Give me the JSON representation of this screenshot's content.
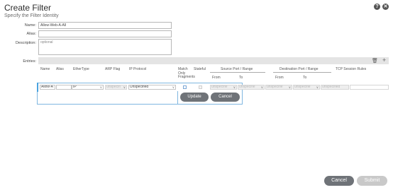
{
  "header": {
    "title": "Create Filter",
    "subtitle": "Specify the Filter Identity",
    "help_icon": "question-icon",
    "close_icon": "close-icon"
  },
  "form": {
    "name_label": "Name:",
    "name_value": "Allow-Web-A-All",
    "alias_label": "Alias:",
    "alias_value": "",
    "description_label": "Description:",
    "description_placeholder": "optional",
    "entries_label": "Entries:"
  },
  "entries": {
    "toolbar_icons": [
      "trash-icon",
      "plus-icon"
    ],
    "columns": {
      "name": "Name",
      "alias": "Alias",
      "ethertype": "EtherType",
      "arp_flag": "ARP Flag",
      "ip_protocol": "IP Protocol",
      "match_only_fragments": [
        "Match",
        "Only",
        "Fragments"
      ],
      "stateful": "Stateful",
      "source_port_range": "Source Port / Range",
      "destination_port_range": "Destination Port / Range",
      "tcp_session_rules": "TCP Session Rules",
      "from": "From",
      "to": "To"
    },
    "row": {
      "name": "Allow-A",
      "alias": "",
      "ethertype": "IP",
      "arp_flag": "unspecifi",
      "ip_protocol": "Unspecified",
      "source_from": "unspecifie",
      "source_to": "unspecifie",
      "dest_from": "unspecifie",
      "dest_to": "unspecifie",
      "tcp_session_rules": "unspecified"
    },
    "update_label": "Update",
    "cancel_label": "Cancel"
  },
  "footer": {
    "cancel_label": "Cancel",
    "submit_label": "Submit"
  },
  "colors": {
    "accent": "#4aa3df",
    "dark_button": "#6f7378",
    "disabled_button": "#c9c9c9"
  }
}
